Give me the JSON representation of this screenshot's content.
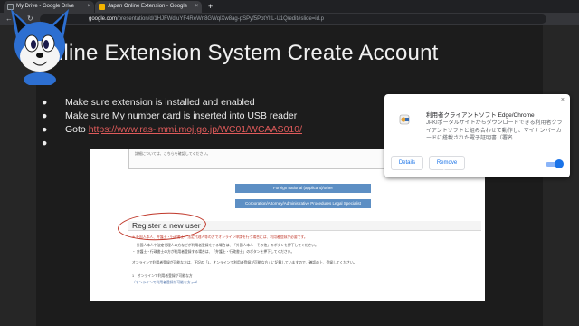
{
  "browser": {
    "tabs": [
      {
        "title": "My Drive - Google Drive",
        "icon": "google-drive-icon",
        "color": "#3c4043"
      },
      {
        "title": "Japan Online Extension - Google",
        "icon": "google-slides-icon",
        "color": "#f4b400"
      }
    ],
    "new_tab_label": "+",
    "url_host": "google.com",
    "url_path": "/presentation/d/1HJFWdluYF4ReWn8GWqlXw8ag-pSPyf5PotYltL-U1Q/edit#slide=id.p"
  },
  "slide": {
    "title": "Online Extension System Create Account",
    "bullets": [
      {
        "text": "Make sure extension is installed and enabled"
      },
      {
        "text": "Make sure My number card is inserted into USB reader"
      },
      {
        "prefix": "Goto ",
        "link": "https://www.ras-immi.moj.go.jp/WC01/WCAAS010/"
      },
      {
        "text": ""
      }
    ]
  },
  "webshot": {
    "prev_text": "詳細については、こちらを確認してください。",
    "button_applicant": "Foreign national (applicant)/other",
    "button_corporation": "Corporation/Attorney/Administrative Procedures Legal Specialist",
    "register_heading": "Register a new user",
    "lines": [
      {
        "text": "※ 外国人本人、弁護士・行政書士、法定代理人等の方でオンライン申請を行う場合には、利用者登録が必要です。",
        "style": "red"
      },
      {
        "text": "・ 外国人本人や法定代理人の方などが利用者登録をする場合は、「外国人本人・その他」のボタンを押下してください。",
        "style": ""
      },
      {
        "text": "・ 弁護士・行政書士の方が利用者登録する場合は、「弁護士・行政書士」のボタンを押下してください。",
        "style": ""
      },
      {
        "text": "オンラインで利用者登録が可能な方は、下記の「1．オンラインで利用者登録が可能な方」に記載していますので、確認の上、登録してください。",
        "style": ""
      },
      {
        "text": "1　オンラインで利用者登録が可能な方",
        "style": ""
      },
      {
        "text": "（オンラインで利用者登録が可能な方.pdf）",
        "style": "blue"
      }
    ]
  },
  "extension": {
    "name": "利用者クライアントソフト Edge/Chrome",
    "description": "JPKIポータルサイトからダウンロードできる利用者クライアントソフトと組み合わせて動作し、マイナンバーカードに搭載された電子証明書（署名",
    "details_label": "Details",
    "remove_label": "Remove",
    "enabled": true,
    "close_glyph": "×"
  },
  "colors": {
    "link": "#e05b5b",
    "accent_blue": "#1a73e8",
    "circle_annotation": "#c0392b"
  }
}
